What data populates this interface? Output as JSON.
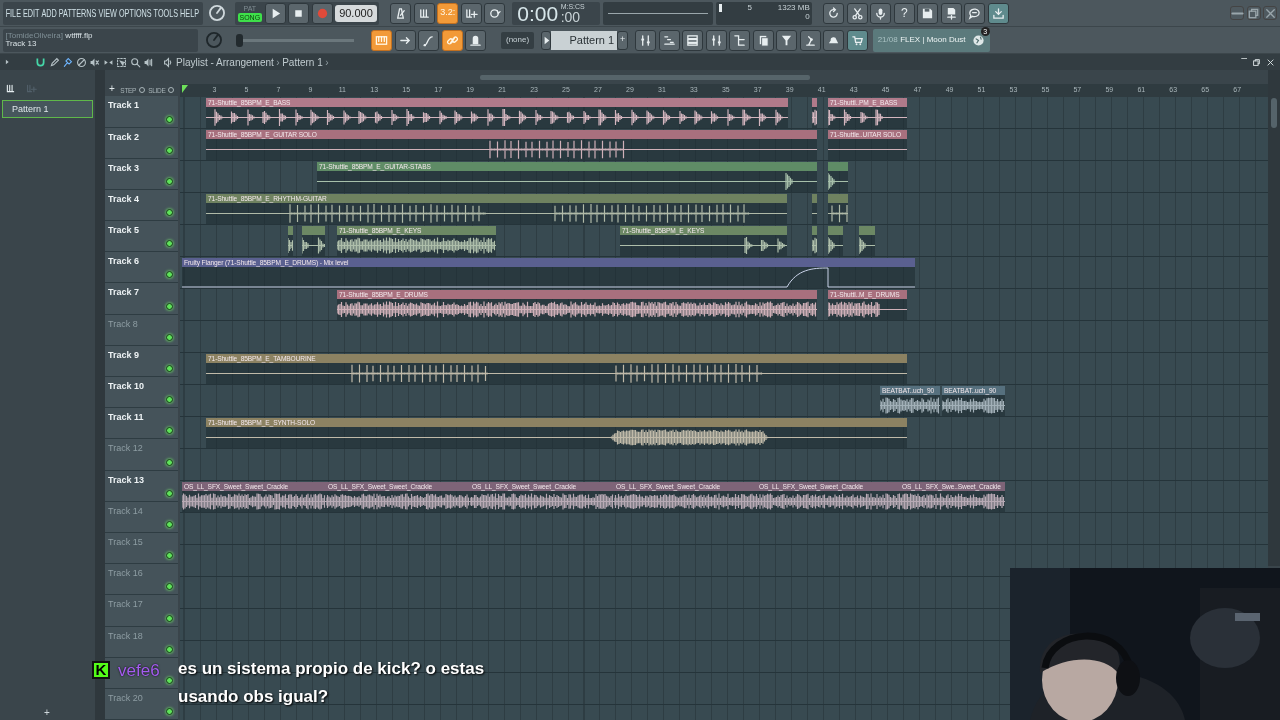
{
  "menu": [
    "FILE",
    "EDIT",
    "ADD",
    "PATTERNS",
    "VIEW",
    "OPTIONS",
    "TOOLS",
    "HELP"
  ],
  "transport": {
    "modes": [
      {
        "label": "PAT",
        "selected": false
      },
      {
        "label": "SONG",
        "selected": true
      }
    ],
    "tempo": "90.000"
  },
  "record_toggles": [
    {
      "on": false
    },
    {
      "on": false
    },
    {
      "on": true,
      "label": "3.2:"
    },
    {
      "on": false
    },
    {
      "on": false
    }
  ],
  "time": {
    "main": "0:00",
    "centiseconds": ":00",
    "unit": "M:S:CS"
  },
  "monitor": {
    "cpu": "5",
    "memory": "1323 MB",
    "polyphony": "0"
  },
  "tools": [
    {
      "highlighted": false
    },
    {
      "highlighted": false
    },
    {
      "highlighted": false
    },
    {
      "highlighted": false,
      "label": "?"
    },
    {
      "highlighted": false
    },
    {
      "highlighted": false
    },
    {
      "highlighted": false
    },
    {
      "highlighted": true
    }
  ],
  "hint": {
    "user": "[TomideOliveira]",
    "file": "wtffff.flp",
    "line2": "Track 13"
  },
  "pitch_slider": {
    "level": 0
  },
  "snap_toggles": [
    {
      "on": true
    },
    {
      "on": false
    },
    {
      "on": false
    },
    {
      "on": true
    },
    {
      "on": false
    }
  ],
  "snap": {
    "value": "(none)"
  },
  "pattern_selector": {
    "value": "Pattern 1",
    "add": "+"
  },
  "window_buttons": [
    {
      "highlighted": false
    },
    {
      "highlighted": false
    },
    {
      "highlighted": false
    },
    {
      "highlighted": false
    },
    {
      "highlighted": false
    },
    {
      "highlighted": false
    },
    {
      "highlighted": false
    },
    {
      "highlighted": false
    },
    {
      "highlighted": false
    },
    {
      "highlighted": true
    }
  ],
  "news": {
    "date": "21/08",
    "title": "FLEX | Moon Dust",
    "badge": "3"
  },
  "playlist": {
    "title": "Playlist - Arrangement",
    "separator": "›",
    "pattern": "Pattern 1",
    "end": "›",
    "patterns": [
      {
        "name": "Pattern 1",
        "selected": true
      }
    ],
    "add_pattern": "+",
    "header": {
      "add": "+",
      "step": {
        "label": "STEP",
        "checked": false
      },
      "slide": {
        "label": "SLIDE",
        "checked": false
      }
    },
    "ruler": [
      "3",
      "5",
      "7",
      "9",
      "11",
      "13",
      "15",
      "17",
      "19",
      "21",
      "23",
      "25",
      "27",
      "29",
      "31",
      "33",
      "35",
      "37",
      "39",
      "41",
      "43",
      "45",
      "47",
      "49",
      "51",
      "53",
      "55",
      "57",
      "59",
      "61",
      "63",
      "65",
      "67"
    ],
    "tracks": [
      {
        "name": "Track 1",
        "dimmed": false,
        "active": true,
        "clips": [
          {
            "kind": "audio",
            "label": "71-Shuttle_85BPM_E_BASS",
            "color": "#b07a8a"
          },
          {
            "kind": "audio",
            "color": "#b07a8a"
          },
          {
            "kind": "audio",
            "label": "71-Shuttl..PM_E_BASS",
            "color": "#b07a8a"
          }
        ]
      },
      {
        "name": "Track 2",
        "dimmed": false,
        "active": true,
        "clips": [
          {
            "kind": "audio",
            "label": "71-Shuttle_85BPM_E_GUITAR SOLO",
            "color": "#a8707e"
          },
          {
            "kind": "audio",
            "label": "71-Shuttle..UITAR SOLO",
            "color": "#a8707e"
          }
        ]
      },
      {
        "name": "Track 3",
        "dimmed": false,
        "active": true,
        "clips": [
          {
            "kind": "audio",
            "label": "71-Shuttle_85BPM_E_GUITAR-STABS",
            "color": "#5f8c66"
          },
          {
            "kind": "audio",
            "color": "#5f8c66"
          }
        ]
      },
      {
        "name": "Track 4",
        "dimmed": false,
        "active": true,
        "clips": [
          {
            "kind": "audio",
            "label": "71-Shuttle_85BPM_E_RHYTHM-GUITAR",
            "color": "#6f8260"
          },
          {
            "kind": "audio",
            "color": "#6f8260"
          },
          {
            "kind": "audio",
            "color": "#6f8260"
          }
        ]
      },
      {
        "name": "Track 5",
        "dimmed": false,
        "active": true,
        "clips": [
          {
            "kind": "audio",
            "color": "#6c8864"
          },
          {
            "kind": "audio",
            "color": "#6c8864"
          },
          {
            "kind": "audio",
            "label": "71-Shuttle_85BPM_E_KEYS",
            "color": "#6c8864"
          },
          {
            "kind": "audio",
            "label": "71-Shuttle_85BPM_E_KEYS",
            "color": "#6c8864"
          },
          {
            "kind": "audio",
            "color": "#6c8864"
          },
          {
            "kind": "audio",
            "color": "#6c8864"
          },
          {
            "kind": "audio",
            "color": "#6c8864"
          }
        ]
      },
      {
        "name": "Track 6",
        "dimmed": false,
        "active": true,
        "clips": [
          {
            "kind": "automation",
            "label": "Fruity Flanger (71-Shuttle_85BPM_E_DRUMS) - Mix level",
            "color": "#5a6090"
          }
        ]
      },
      {
        "name": "Track 7",
        "dimmed": false,
        "active": true,
        "clips": [
          {
            "kind": "audio",
            "label": "71-Shuttle_85BPM_E_DRUMS",
            "color": "#a8707e"
          },
          {
            "kind": "audio",
            "label": "71-Shuttl..M_E_DRUMS",
            "color": "#a8707e"
          }
        ]
      },
      {
        "name": "Track 8",
        "dimmed": true,
        "active": true
      },
      {
        "name": "Track 9",
        "dimmed": false,
        "active": true,
        "clips": [
          {
            "kind": "audio",
            "label": "71-Shuttle_85BPM_E_TAMBOURINE",
            "color": "#8c8262"
          }
        ]
      },
      {
        "name": "Track 10",
        "dimmed": false,
        "active": true,
        "clips": [
          {
            "kind": "audio",
            "label": "BEATBAT..uch_90",
            "color": "#56707e"
          },
          {
            "kind": "audio",
            "label": "BEATBAT..uch_90",
            "color": "#56707e"
          }
        ]
      },
      {
        "name": "Track 11",
        "dimmed": false,
        "active": true,
        "clips": [
          {
            "kind": "audio",
            "label": "71-Shuttle_85BPM_E_SYNTH-SOLO",
            "color": "#8c8262"
          }
        ]
      },
      {
        "name": "Track 12",
        "dimmed": true,
        "active": true
      },
      {
        "name": "Track 13",
        "dimmed": false,
        "active": true,
        "clips": [
          {
            "kind": "audio",
            "label": "OS_LL_SFX_Sweet_Sweet_Crackle",
            "color": "#7e6478"
          },
          {
            "kind": "audio",
            "label": "OS_LL_SFX_Sweet_Sweet_Crackle",
            "color": "#7e6478"
          },
          {
            "kind": "audio",
            "label": "OS_LL_SFX_Sweet_Sweet_Crackle",
            "color": "#7e6478"
          },
          {
            "kind": "audio",
            "label": "OS_LL_SFX_Sweet_Sweet_Crackle",
            "color": "#7e6478"
          },
          {
            "kind": "audio",
            "label": "OS_LL_SFX_Sweet_Sweet_Crackle",
            "color": "#7e6478"
          },
          {
            "kind": "audio",
            "label": "OS_LL_SFX_Swe..Sweet_Crackle",
            "color": "#7e6478"
          }
        ]
      },
      {
        "name": "Track 14",
        "dimmed": true,
        "active": true
      },
      {
        "name": "Track 15",
        "dimmed": true,
        "active": true
      },
      {
        "name": "Track 16",
        "dimmed": true,
        "active": true
      },
      {
        "name": "Track 17",
        "dimmed": true,
        "active": true
      },
      {
        "name": "Track 18",
        "dimmed": true,
        "active": true
      },
      {
        "active": true
      },
      {
        "name": "Track 20",
        "dimmed": true,
        "active": true
      }
    ]
  },
  "chat": {
    "badge": "K",
    "user": "vefe6",
    "message": "es un sistema propio de kick? o estas usando obs igual?"
  }
}
